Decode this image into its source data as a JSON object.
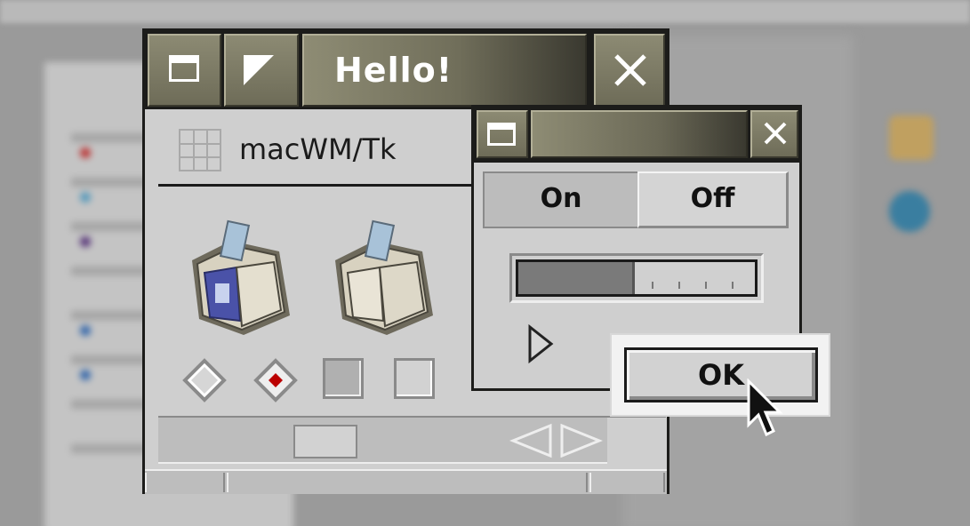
{
  "main_window": {
    "title": "Hello!",
    "app_name": "macWM/Tk"
  },
  "toggle": {
    "on_label": "On",
    "off_label": "Off",
    "selected": "On"
  },
  "progress": {
    "value": 0.48
  },
  "dialog": {
    "ok_label": "OK"
  },
  "colors": {
    "titlebar_gradient_start": "#8e8c74",
    "titlebar_gradient_end": "#3a3930",
    "window_bg": "#cfcfcf",
    "frame": "#1c1c1a"
  }
}
